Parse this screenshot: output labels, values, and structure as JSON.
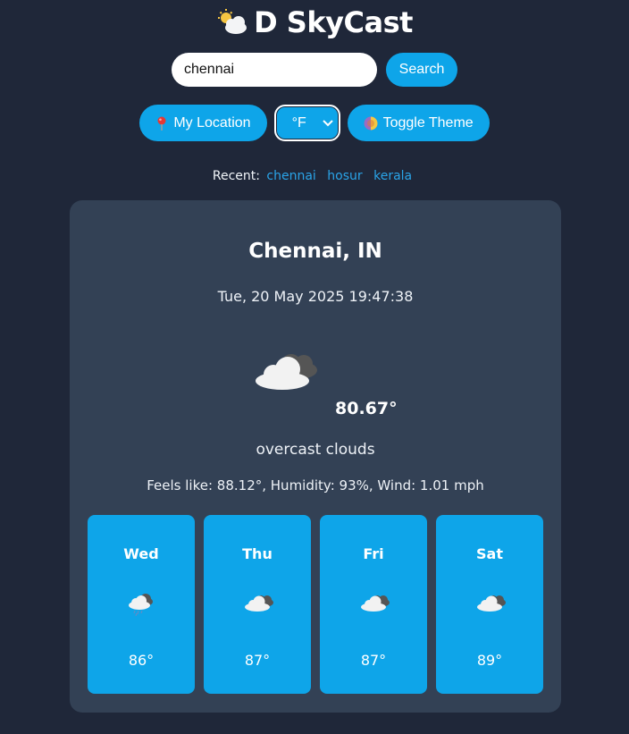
{
  "app": {
    "title_icon": "sun-behind-cloud-icon",
    "title": "D SkyCast"
  },
  "search": {
    "value": "chennai",
    "placeholder": "",
    "button_label": "Search"
  },
  "controls": {
    "location_icon": "pin-icon",
    "location_label": "My Location",
    "unit_selected": "°F",
    "theme_icon": "half-moon-icon",
    "theme_label": "Toggle Theme"
  },
  "recent": {
    "label": "Recent:",
    "items": [
      "chennai",
      "hosur",
      "kerala"
    ]
  },
  "current": {
    "city": "Chennai, IN",
    "datetime": "Tue, 20 May 2025 19:47:38",
    "icon": "overcast-clouds-icon",
    "temperature": "80.67°",
    "description": "overcast clouds",
    "details": "Feels like: 88.12°, Humidity: 93%, Wind: 1.01 mph"
  },
  "forecast": [
    {
      "day": "Wed",
      "icon": "rain-cloud-icon",
      "temp": "86°"
    },
    {
      "day": "Thu",
      "icon": "overcast-clouds-icon",
      "temp": "87°"
    },
    {
      "day": "Fri",
      "icon": "overcast-clouds-icon",
      "temp": "87°"
    },
    {
      "day": "Sat",
      "icon": "overcast-clouds-icon",
      "temp": "89°"
    }
  ],
  "colors": {
    "background": "#1f2739",
    "card": "#334155",
    "accent": "#0ea5e9",
    "link": "#2aa4e8"
  }
}
